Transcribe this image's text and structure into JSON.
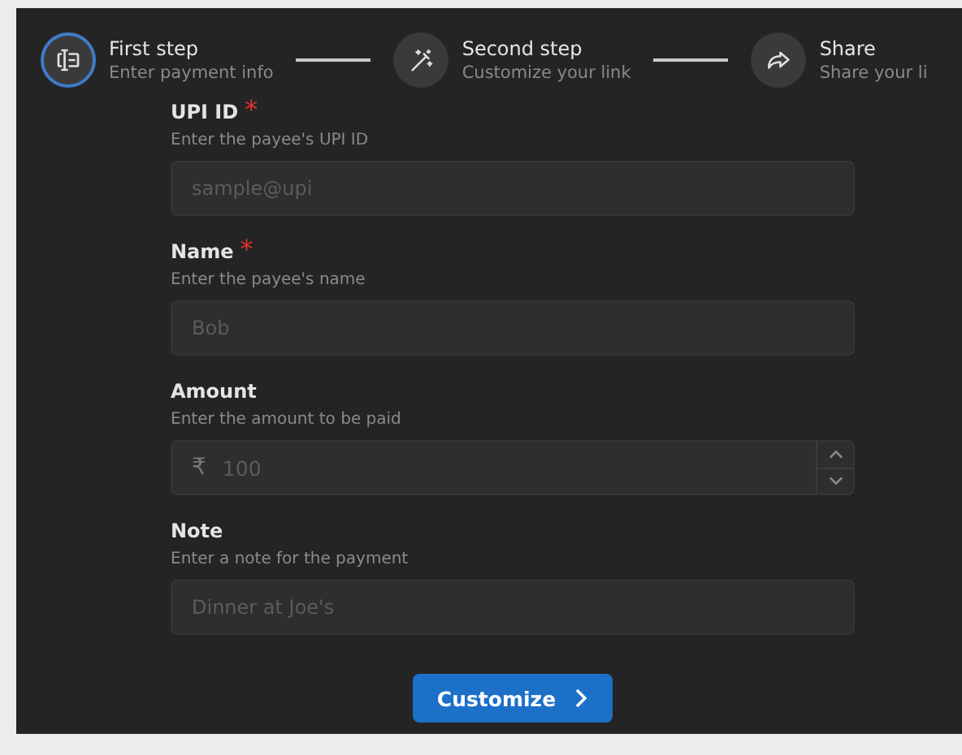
{
  "steps": [
    {
      "title": "First step",
      "subtitle": "Enter payment info",
      "selected": true
    },
    {
      "title": "Second step",
      "subtitle": "Customize your link",
      "selected": false
    },
    {
      "title": "Share",
      "subtitle": "Share your li",
      "selected": false
    }
  ],
  "fields": [
    {
      "kind": "text",
      "label": "UPI ID",
      "required_mark": "*",
      "hint": "Enter the payee's UPI ID",
      "placeholder": "sample@upi"
    },
    {
      "kind": "text",
      "label": "Name",
      "required_mark": "*",
      "hint": "Enter the payee's name",
      "placeholder": "Bob"
    },
    {
      "kind": "amount",
      "label": "Amount",
      "hint": "Enter the amount to be paid",
      "prefix": "₹",
      "placeholder": "100"
    },
    {
      "kind": "text",
      "label": "Note",
      "hint": "Enter a note for the payment",
      "placeholder": "Dinner at Joe's"
    }
  ],
  "button": {
    "label": "Customize"
  }
}
